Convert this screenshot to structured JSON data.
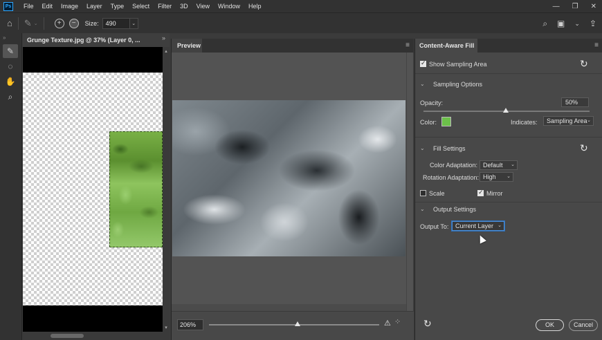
{
  "app": {
    "logo": "Ps"
  },
  "menu": [
    "File",
    "Edit",
    "Image",
    "Layer",
    "Type",
    "Select",
    "Filter",
    "3D",
    "View",
    "Window",
    "Help"
  ],
  "window_controls": {
    "minimize": "—",
    "restore": "❐",
    "close": "✕"
  },
  "options_bar": {
    "size_label": "Size:",
    "size_value": "490",
    "add_glyph": "+",
    "subtract_glyph": "−",
    "dropdown_glyph": "⌄"
  },
  "document": {
    "tab_title": "Grunge Texture.jpg @ 37% (Layer 0, ...",
    "collapse_glyph": "»"
  },
  "preview": {
    "tab_label": "Preview",
    "zoom_value": "206%",
    "zoom_level": 0.52,
    "menu_glyph": "≡"
  },
  "content_aware_fill": {
    "tab_label": "Content-Aware Fill",
    "show_sampling_area": {
      "label": "Show Sampling Area",
      "checked": true
    },
    "sampling_options": {
      "heading": "Sampling Options",
      "opacity_label": "Opacity:",
      "opacity_value": "50%",
      "color_label": "Color:",
      "color_hex": "#6cc04a",
      "indicates_label": "Indicates:",
      "indicates_value": "Sampling Area"
    },
    "fill_settings": {
      "heading": "Fill Settings",
      "color_adaptation_label": "Color Adaptation:",
      "color_adaptation_value": "Default",
      "rotation_adaptation_label": "Rotation Adaptation:",
      "rotation_adaptation_value": "High",
      "scale_label": "Scale",
      "scale_checked": false,
      "mirror_label": "Mirror",
      "mirror_checked": true
    },
    "output_settings": {
      "heading": "Output Settings",
      "output_to_label": "Output To:",
      "output_to_value": "Current Layer"
    },
    "ok_label": "OK",
    "cancel_label": "Cancel"
  },
  "colors": {
    "accent_focus": "#4d8fd6",
    "sampling_green": "#6cc04a",
    "panel_bg": "#484848"
  }
}
